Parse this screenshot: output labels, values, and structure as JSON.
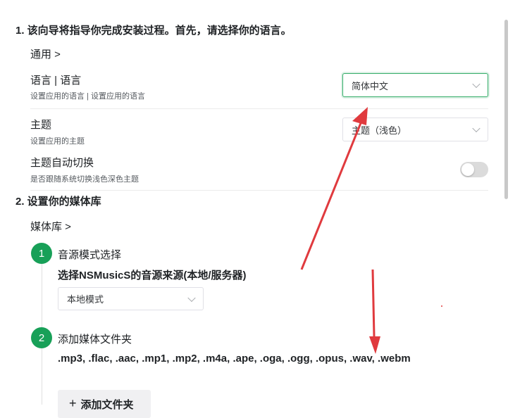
{
  "step1": {
    "title": "1. 该向导将指导你完成安装过程。首先，请选择你的语言。",
    "section_link": "通用 >",
    "language": {
      "label": "语言 | 语言",
      "desc": "设置应用的语言 | 设置应用的语言",
      "value": "简体中文"
    },
    "theme": {
      "label": "主题",
      "desc": "设置应用的主题",
      "value": "主题（浅色）"
    },
    "auto_theme": {
      "label": "主题自动切换",
      "desc": "是否跟随系统切换浅色深色主题",
      "enabled": false
    }
  },
  "step2": {
    "title": "2. 设置你的媒体库",
    "section_link": "媒体库 >",
    "items": [
      {
        "number": "1",
        "title": "音源模式选择",
        "subtitle": "选择NSMusicS的音源来源(本地/服务器)",
        "select_value": "本地模式"
      },
      {
        "number": "2",
        "title": "添加媒体文件夹",
        "formats": ".mp3, .flac, .aac, .mp1, .mp2, .m4a, .ape, .oga, .ogg, .opus, .wav, .webm",
        "button_label": "添加文件夹"
      }
    ]
  },
  "colors": {
    "accent": "#18a058",
    "annotation": "#e03a3e"
  }
}
